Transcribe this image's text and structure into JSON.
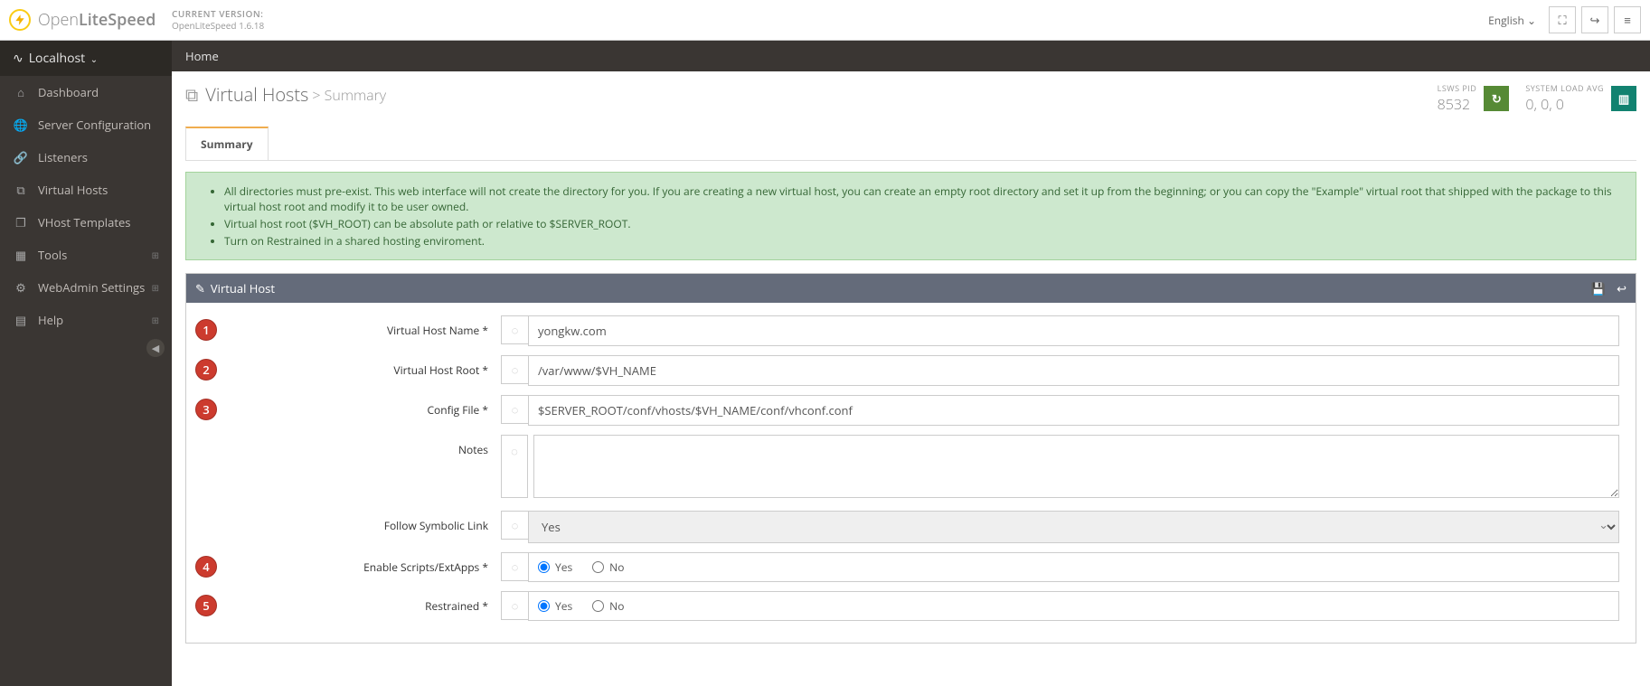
{
  "header": {
    "logo_open": "Open",
    "logo_rest": "LiteSpeed",
    "version_label": "CURRENT VERSION:",
    "version_value": "OpenLiteSpeed 1.6.18",
    "language": "English"
  },
  "sidebar": {
    "host": "Localhost",
    "items": [
      {
        "icon": "home",
        "label": "Dashboard"
      },
      {
        "icon": "globe",
        "label": "Server Configuration"
      },
      {
        "icon": "link",
        "label": "Listeners"
      },
      {
        "icon": "sitemap",
        "label": "Virtual Hosts"
      },
      {
        "icon": "clone",
        "label": "VHost Templates"
      },
      {
        "icon": "grid",
        "label": "Tools",
        "plus": true
      },
      {
        "icon": "gear",
        "label": "WebAdmin Settings",
        "plus": true
      },
      {
        "icon": "book",
        "label": "Help",
        "plus": true
      }
    ]
  },
  "breadcrumb": "Home",
  "page": {
    "title": "Virtual Hosts",
    "subtitle": "> Summary",
    "pid_label": "LSWS PID",
    "pid_value": "8532",
    "load_label": "SYSTEM LOAD AVG",
    "load_value": "0, 0, 0"
  },
  "tab": "Summary",
  "notice": [
    "All directories must pre-exist. This web interface will not create the directory for you. If you are creating a new virtual host, you can create an empty root directory and set it up from the beginning; or you can copy the \"Example\" virtual root that shipped with the package to this virtual host root and modify it to be user owned.",
    "Virtual host root ($VH_ROOT) can be absolute path or relative to $SERVER_ROOT.",
    "Turn on Restrained in a shared hosting enviroment."
  ],
  "panel_title": "Virtual Host",
  "form": {
    "vh_name_label": "Virtual Host Name *",
    "vh_name_value": "yongkw.com",
    "vh_root_label": "Virtual Host Root *",
    "vh_root_value": "/var/www/$VH_NAME",
    "config_label": "Config File *",
    "config_value": "$SERVER_ROOT/conf/vhosts/$VH_NAME/conf/vhconf.conf",
    "notes_label": "Notes",
    "symlink_label": "Follow Symbolic Link",
    "symlink_value": "Yes",
    "scripts_label": "Enable Scripts/ExtApps *",
    "restrained_label": "Restrained *",
    "opt_yes": "Yes",
    "opt_no": "No"
  },
  "annotations": {
    "1": "1",
    "2": "2",
    "3": "3",
    "4": "4",
    "5": "5"
  }
}
